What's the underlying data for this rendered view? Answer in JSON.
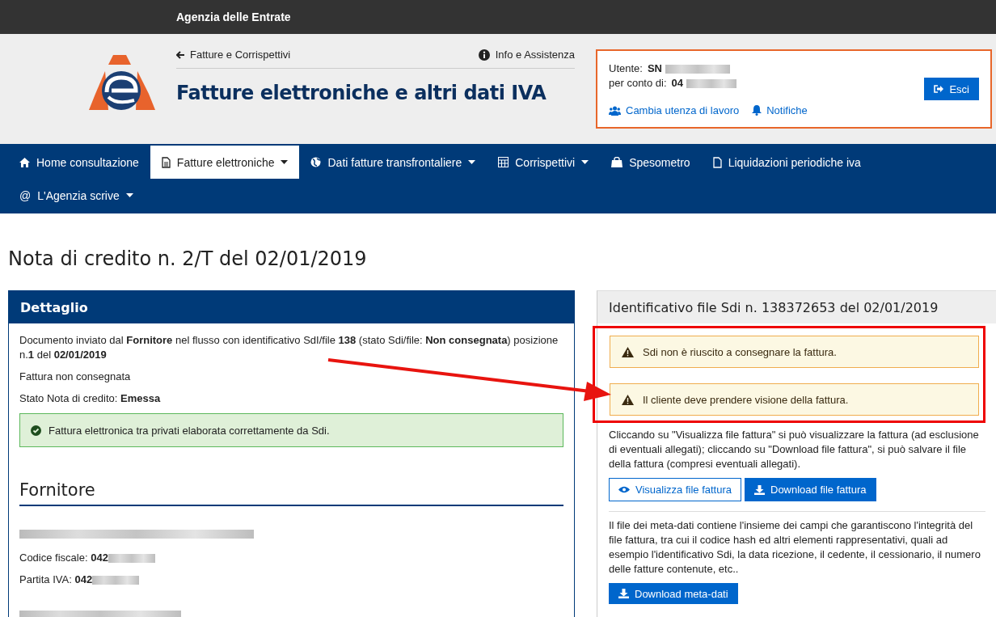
{
  "top_bar": {
    "title": "Agenzia delle Entrate"
  },
  "header": {
    "back_link": "Fatture e Corrispettivi",
    "info_link": "Info e Assistenza",
    "title": "Fatture elettroniche e altri dati IVA"
  },
  "user_box": {
    "user_label": "Utente:",
    "user_value": "SN",
    "on_behalf_label": "per conto di:",
    "on_behalf_value": "04",
    "links": [
      {
        "kind": "users",
        "label": "Cambia utenza di lavoro"
      },
      {
        "kind": "bell",
        "label": "Notifiche"
      }
    ],
    "logout_button": "Esci"
  },
  "nav": [
    {
      "kind": "home",
      "label": "Home consultazione",
      "dropdown": false,
      "selected": false
    },
    {
      "kind": "document",
      "label": "Fatture elettroniche",
      "dropdown": true,
      "selected": true
    },
    {
      "kind": "globe",
      "label": "Dati fatture transfrontaliere",
      "dropdown": true,
      "selected": false
    },
    {
      "kind": "calculator",
      "label": "Corrispettivi",
      "dropdown": true,
      "selected": false
    },
    {
      "kind": "bag",
      "label": "Spesometro",
      "dropdown": false,
      "selected": false
    },
    {
      "kind": "file",
      "label": "Liquidazioni periodiche iva",
      "dropdown": false,
      "selected": false
    },
    {
      "kind": "at",
      "symbol": "@",
      "label": "L'Agenzia scrive",
      "dropdown": true,
      "selected": false
    }
  ],
  "page_title": "Nota di credito n. 2/T del 02/01/2019",
  "detail": {
    "title": "Dettaglio",
    "paragraphs": [
      "Documento inviato dal **Fornitore** nel flusso con identificativo SdI/file **138** (stato Sdi/file: **Non consegnata**) posizione n.**1** del **02/01/2019**",
      "Fattura non consegnata",
      "Stato Nota di credito: **Emessa**"
    ],
    "success_message": "Fattura elettronica tra privati elaborata correttamente da Sdi.",
    "section_title": "Fornitore",
    "fields": [
      {
        "label": "Codice fiscale:",
        "value": "042"
      },
      {
        "label": "Partita IVA:",
        "value": "042"
      }
    ]
  },
  "sdi_panel": {
    "title": "Identificativo file Sdi n. 138372653 del 02/01/2019",
    "warnings": [
      "Sdi non è riuscito a consegnare la fattura.",
      "Il cliente deve prendere visione della fattura."
    ],
    "highlighted": true,
    "file_text": "Cliccando su \"Visualizza file fattura\" si può visualizzare la fattura (ad esclusione di eventuali allegati); cliccando su \"Download file fattura\", si può salvare il file della fattura (compresi eventuali allegati).",
    "view_button": "Visualizza file fattura",
    "download_button": "Download file fattura",
    "metadata_text": "Il file dei meta-dati contiene l'insieme dei campi che garantiscono l'integrità del file fattura, tra cui il codice hash ed altri elementi rappresentativi, quali ad esempio l'identificativo Sdi, la data ricezione, il cedente, il cessionario, il numero delle fatture contenute, etc..",
    "metadata_button": "Download meta-dati"
  }
}
